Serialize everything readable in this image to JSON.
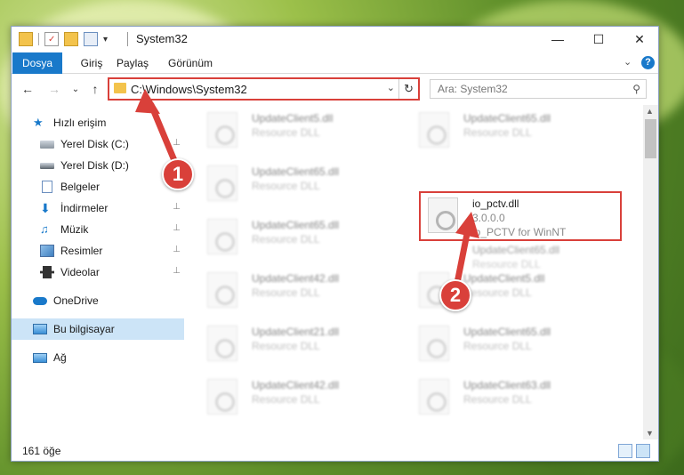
{
  "titlebar": {
    "title": "System32",
    "minimize": "—",
    "maximize": "☐",
    "close": "✕"
  },
  "ribbon": {
    "tabs": [
      "Dosya",
      "Giriş",
      "Paylaş",
      "Görünüm"
    ],
    "expand": "⌄",
    "help": "?"
  },
  "nav": {
    "back": "←",
    "forward": "→",
    "recent": "⌄",
    "up": "↑",
    "address": "C:\\Windows\\System32",
    "address_drop": "⌄",
    "refresh": "↻",
    "search_placeholder": "Ara: System32",
    "search_icon": "⚲"
  },
  "sidebar": {
    "items": [
      {
        "label": "Hızlı erişim",
        "icon": "star-icon"
      },
      {
        "label": "Yerel Disk (C:)",
        "icon": "drive-icon",
        "pinned": true
      },
      {
        "label": "Yerel Disk (D:)",
        "icon": "drive-icon"
      },
      {
        "label": "Belgeler",
        "icon": "documents-icon",
        "pinned": true
      },
      {
        "label": "İndirmeler",
        "icon": "download-icon",
        "pinned": true
      },
      {
        "label": "Müzik",
        "icon": "music-icon",
        "pinned": true
      },
      {
        "label": "Resimler",
        "icon": "pictures-icon",
        "pinned": true
      },
      {
        "label": "Videolar",
        "icon": "videos-icon",
        "pinned": true
      },
      {
        "label": "OneDrive",
        "icon": "cloud-icon"
      },
      {
        "label": "Bu bilgisayar",
        "icon": "computer-icon",
        "selected": true
      },
      {
        "label": "Ağ",
        "icon": "network-icon"
      }
    ],
    "pin_glyph": "📌"
  },
  "files": {
    "left": [
      {
        "name": "UpdateClient5.dll",
        "desc": "Resource DLL"
      },
      {
        "name": "UpdateClient65.dll",
        "desc": "Resource DLL"
      },
      {
        "name": "UpdateClient65.dll",
        "desc": "Resource DLL"
      },
      {
        "name": "UpdateClient42.dll",
        "desc": "Resource DLL"
      },
      {
        "name": "UpdateClient21.dll",
        "desc": "Resource DLL"
      },
      {
        "name": "UpdateClient42.dll",
        "desc": "Resource DLL"
      }
    ],
    "right": [
      {
        "name": "UpdateClient65.dll",
        "desc": "Resource DLL"
      },
      {
        "name": "io_pctv.dll",
        "version": "3.0.0.0",
        "desc": "io_PCTV for WinNT",
        "highlighted": true
      },
      {
        "name": "UpdateClient65.dll",
        "desc": "Resource DLL"
      },
      {
        "name": "UpdateClient5.dll",
        "desc": "Resource DLL"
      },
      {
        "name": "UpdateClient65.dll",
        "desc": "Resource DLL"
      },
      {
        "name": "UpdateClient63.dll",
        "desc": "Resource DLL"
      }
    ]
  },
  "status": {
    "count": "161 öğe"
  },
  "annotations": {
    "marker1": "1",
    "marker2": "2",
    "color": "#d9403a"
  },
  "colors": {
    "accent": "#1979ca",
    "selected_bg": "#cce4f7",
    "highlight": "#d9403a"
  }
}
